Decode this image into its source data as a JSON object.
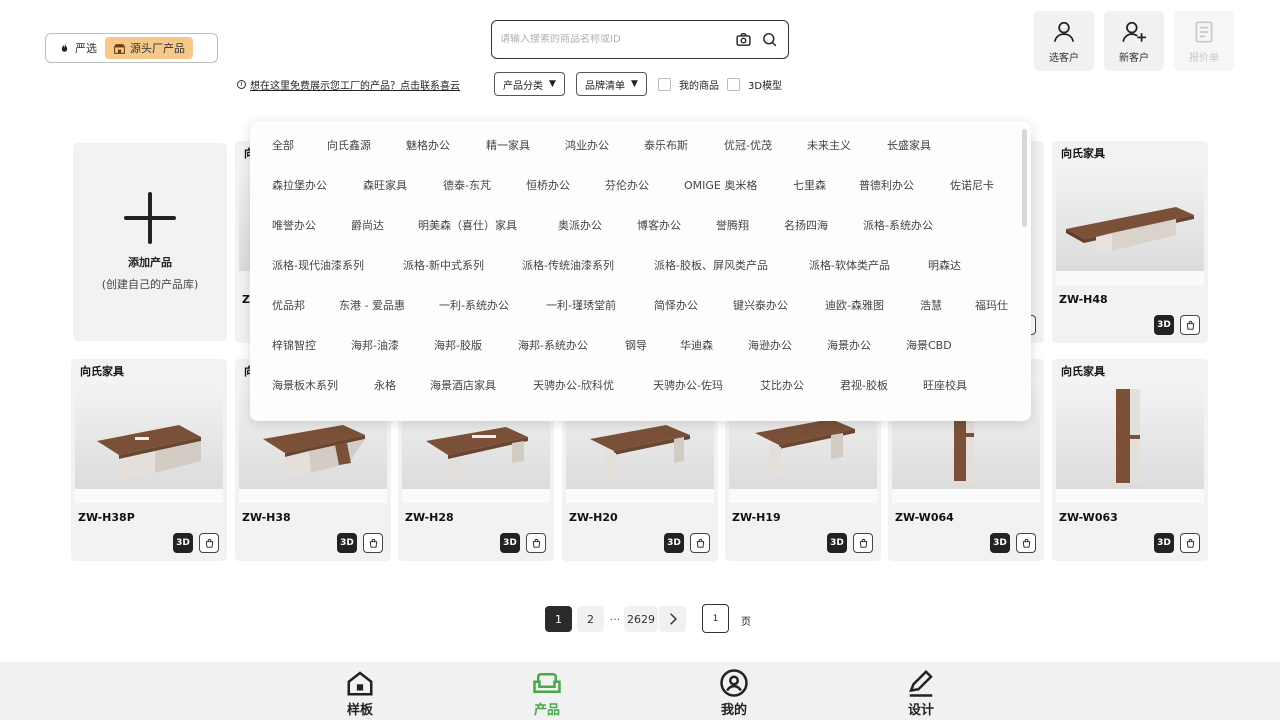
{
  "toggle": {
    "option1": "严选",
    "option2": "源头厂产品"
  },
  "search": {
    "placeholder": "请输入搜索的商品名称或ID"
  },
  "promo": {
    "text": "想在这里免费展示您工厂的产品？点击联系喜云"
  },
  "filters": {
    "category": "产品分类",
    "brand": "品牌清单",
    "mine": "我的商品",
    "model3d": "3D模型"
  },
  "actions": {
    "select_customer": "选客户",
    "new_customer": "新客户",
    "quote": "报价单"
  },
  "add_card": {
    "title": "添加产品",
    "subtitle": "(创建自己的产品库)"
  },
  "cards_row1": [
    {
      "brand": "向",
      "code": "Z"
    },
    {
      "brand": "向氏家具",
      "code": "ZW-H48"
    }
  ],
  "cards_row2": [
    {
      "brand": "向氏家具",
      "code": "ZW-H38P"
    },
    {
      "brand": "向",
      "code": "ZW-H38"
    },
    {
      "brand": "",
      "code": "ZW-H28"
    },
    {
      "brand": "",
      "code": "ZW-H20"
    },
    {
      "brand": "",
      "code": "ZW-H19"
    },
    {
      "brand": "",
      "code": "ZW-W064"
    },
    {
      "brand": "向氏家具",
      "code": "ZW-W063"
    }
  ],
  "badge_3d": "3D",
  "brand_dropdown": [
    [
      "全部",
      "向氏鑫源",
      "魅格办公",
      "精一家具",
      "鸿业办公",
      "泰乐布斯",
      "优冠-优茂",
      "未来主义",
      "长盛家具"
    ],
    [
      "森拉堡办公",
      "森旺家具",
      "德泰-东芃",
      "恒桥办公",
      "芬伦办公",
      "OMIGE 奥米格",
      "七里森",
      "普德利办公",
      "佐诺尼卡"
    ],
    [
      "唯誉办公",
      "爵尚达",
      "明美森（喜仕）家具",
      "奥派办公",
      "博客办公",
      "誉腾翔",
      "名扬四海",
      "派格-系统办公"
    ],
    [
      "派格-现代油漆系列",
      "派格-新中式系列",
      "派格-传统油漆系列",
      "派格-胶板、屏风类产品",
      "派格-软体类产品",
      "明森达"
    ],
    [
      "优品邦",
      "东港 - 爱品惠",
      "一利-系统办公",
      "一利-瑾琇堂前",
      "简怿办公",
      "键兴泰办公",
      "迪欧-森雅图",
      "浩慧",
      "福玛仕"
    ],
    [
      "梓锦智控",
      "海邦-油漆",
      "海邦-胶版",
      "海邦-系统办公",
      "钢导",
      "华迪森",
      "海逊办公",
      "海景办公",
      "海景CBD"
    ],
    [
      "海景板木系列",
      "永格",
      "海景酒店家具",
      "天骋办公-欣科优",
      "天骋办公-佐玛",
      "艾比办公",
      "君视-胶板",
      "旺座校具"
    ]
  ],
  "pagination": {
    "current": "1",
    "next": "2",
    "ellipsis": "···",
    "last": "2629",
    "jump_value": "1",
    "unit": "页"
  },
  "bottom_nav": {
    "sample": "样板",
    "product": "产品",
    "mine": "我的",
    "design": "设计",
    "active_color": "#4aa84a"
  }
}
